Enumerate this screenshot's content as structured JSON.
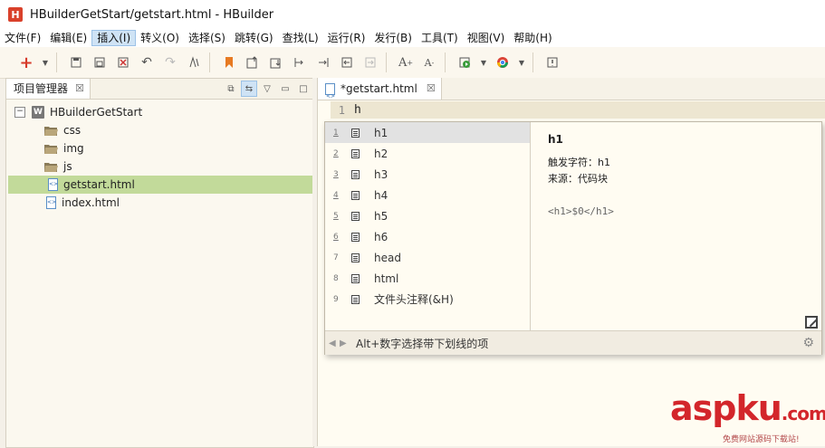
{
  "window": {
    "app_logo": "H",
    "title": "HBuilderGetStart/getstart.html  -  HBuilder"
  },
  "menu": [
    {
      "label": "文件(F)"
    },
    {
      "label": "编辑(E)"
    },
    {
      "label": "插入(I)",
      "active": true
    },
    {
      "label": "转义(O)"
    },
    {
      "label": "选择(S)"
    },
    {
      "label": "跳转(G)"
    },
    {
      "label": "查找(L)"
    },
    {
      "label": "运行(R)"
    },
    {
      "label": "发行(B)"
    },
    {
      "label": "工具(T)"
    },
    {
      "label": "视图(V)"
    },
    {
      "label": "帮助(H)"
    }
  ],
  "project_panel": {
    "tab_label": "项目管理器",
    "tree": [
      {
        "label": "HBuilderGetStart",
        "type": "project",
        "icon": "W",
        "expanded_glyph": "−"
      },
      {
        "label": "css",
        "type": "folder"
      },
      {
        "label": "img",
        "type": "folder"
      },
      {
        "label": "js",
        "type": "folder"
      },
      {
        "label": "getstart.html",
        "type": "file",
        "selected": true
      },
      {
        "label": "index.html",
        "type": "file"
      }
    ]
  },
  "editor": {
    "tab_label": "*getstart.html",
    "line_number": "1",
    "code": "h"
  },
  "content_assist": {
    "proposals": [
      {
        "num": "1",
        "label": "h1",
        "selected": true,
        "underline": true
      },
      {
        "num": "2",
        "label": "h2",
        "underline": true
      },
      {
        "num": "3",
        "label": "h3",
        "underline": true
      },
      {
        "num": "4",
        "label": "h4",
        "underline": true
      },
      {
        "num": "5",
        "label": "h5",
        "underline": true
      },
      {
        "num": "6",
        "label": "h6",
        "underline": true
      },
      {
        "num": "7",
        "label": "head",
        "underline": false
      },
      {
        "num": "8",
        "label": "html",
        "underline": false
      },
      {
        "num": "9",
        "label": "文件头注释(&H)",
        "underline": false
      }
    ],
    "detail": {
      "title": "h1",
      "trigger": "触发字符：h1",
      "source": "来源：代码块",
      "snippet": "<h1>$0</h1>"
    },
    "status_text": "Alt+数字选择带下划线的项"
  },
  "watermark": {
    "brand": "aspku",
    "suffix": ".com",
    "tagline": "免费网站源码下载站!"
  },
  "colors": {
    "selected_tree_row": "#c2da9a",
    "active_menu": "#cfe3f5",
    "watermark_red": "#d3262b"
  }
}
